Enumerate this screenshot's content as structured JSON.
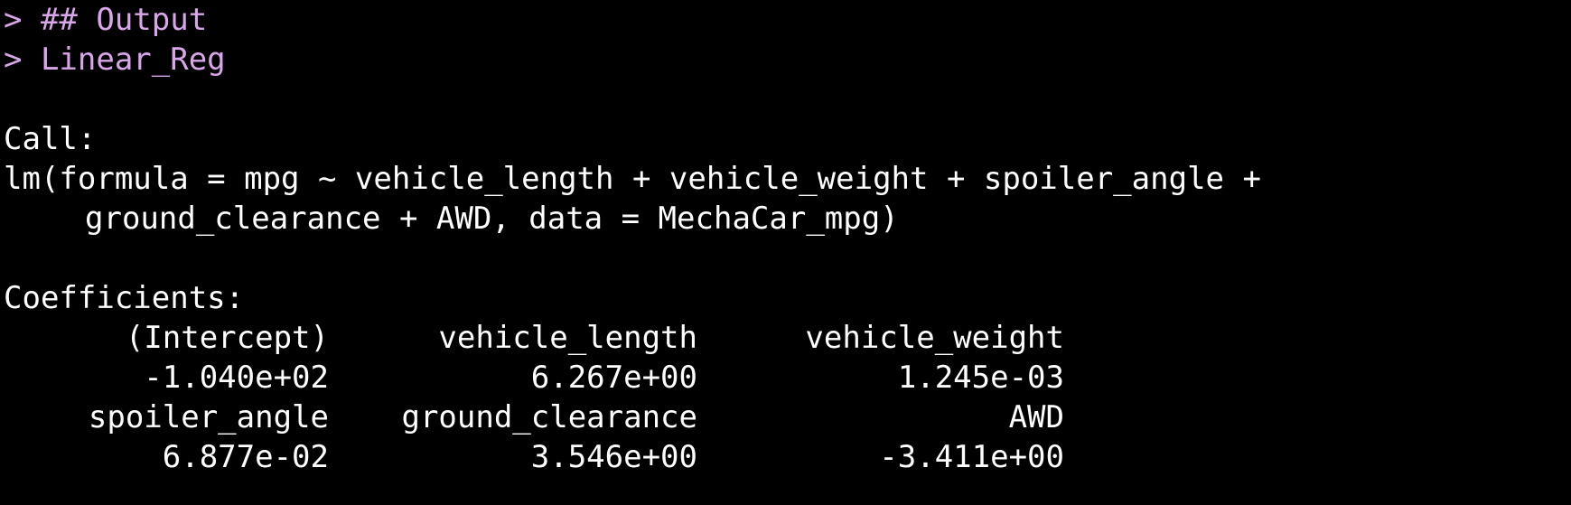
{
  "console": {
    "input_lines": [
      "> ## Output",
      "> Linear_Reg"
    ],
    "call_label": "Call:",
    "call_lines": [
      "lm(formula = mpg ~ vehicle_length + vehicle_weight + spoiler_angle +",
      "ground_clearance + AWD, data = MechaCar_mpg)"
    ],
    "coefficients_label": "Coefficients:",
    "coefficient_rows": [
      [
        "(Intercept)",
        "vehicle_length",
        "vehicle_weight"
      ],
      [
        "-1.040e+02",
        "6.267e+00",
        "1.245e-03"
      ],
      [
        "spoiler_angle",
        "ground_clearance",
        "AWD"
      ],
      [
        "6.877e-02",
        "3.546e+00",
        "-3.411e+00"
      ]
    ]
  },
  "colors": {
    "background": "#000000",
    "input_text": "#d9a6ea",
    "output_text": "#ffffff"
  }
}
